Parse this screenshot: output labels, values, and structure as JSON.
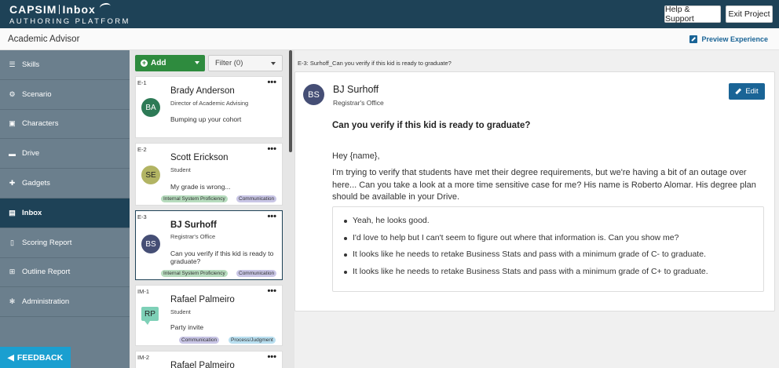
{
  "app": {
    "brand_main": "CAPSIM|Inbox",
    "brand_part1": "CAPSIM",
    "brand_part2": "Inbox",
    "brand_sub": "AUTHORING PLATFORM",
    "help_label": "Help & Support",
    "exit_label": "Exit Project"
  },
  "subheader": {
    "title": "Academic Advisor",
    "preview_label": "Preview Experience"
  },
  "sidebar": {
    "items": [
      {
        "label": "Skills",
        "icon": "list-icon"
      },
      {
        "label": "Scenario",
        "icon": "scenario-icon"
      },
      {
        "label": "Characters",
        "icon": "id-card-icon"
      },
      {
        "label": "Drive",
        "icon": "folder-icon"
      },
      {
        "label": "Gadgets",
        "icon": "puzzle-icon"
      },
      {
        "label": "Inbox",
        "icon": "inbox-icon",
        "active": true
      },
      {
        "label": "Scoring Report",
        "icon": "document-icon"
      },
      {
        "label": "Outline Report",
        "icon": "sitemap-icon"
      },
      {
        "label": "Administration",
        "icon": "gear-icon"
      }
    ],
    "feedback_label": "FEEDBACK"
  },
  "list": {
    "add_label": "Add",
    "filter_label": "Filter (0)",
    "cards": [
      {
        "id": "E-1",
        "initials": "BA",
        "name": "Brady Anderson",
        "role": "Director of Academic Advising",
        "preview": "Bumping up your cohort",
        "tags": []
      },
      {
        "id": "E-2",
        "initials": "SE",
        "name": "Scott Erickson",
        "role": "Student",
        "preview": "My grade is wrong...",
        "tags": [
          "Internal System Proficiency",
          "Communication"
        ]
      },
      {
        "id": "E-3",
        "initials": "BS",
        "name": "BJ Surhoff",
        "role": "Registrar's Office",
        "preview": "Can you verify if this kid is ready to graduate?",
        "tags": [
          "Internal System Proficiency",
          "Communication"
        ]
      },
      {
        "id": "IM-1",
        "initials": "RP",
        "name": "Rafael Palmeiro",
        "role": "Student",
        "preview": "Party invite",
        "tags": [
          "Communication",
          "Process/Judgment"
        ]
      },
      {
        "id": "IM-2",
        "initials": "",
        "name": "Rafael Palmeiro",
        "role": "",
        "preview": "",
        "tags": []
      }
    ]
  },
  "detail": {
    "breadcrumb": "E-3: Surhoff_Can you verify if this kid is ready to graduate?",
    "initials": "BS",
    "sender": "BJ Surhoff",
    "role": "Registrar's Office",
    "edit_label": "Edit",
    "subject": "Can you verify if this kid is ready to graduate?",
    "greeting": "Hey {name},",
    "body": "I'm trying to verify that students have met their degree requirements, but we're having a bit of an outage over here... Can you take a look at a more time sensitive case for me? His name is Roberto Alomar. His degree plan should be available in your Drive.",
    "options": [
      "Yeah, he looks good.",
      "I'd love to help but I can't seem to figure out where that information is. Can you show me?",
      "It looks like he needs to retake Business Stats and pass with a minimum grade of C- to graduate.",
      "It looks like he needs to retake Business Stats and pass with a minimum grade of C+ to graduate."
    ]
  },
  "colors": {
    "topbar": "#1e4257",
    "sidebar": "#6b7f8d",
    "add_button": "#2e8b3e",
    "edit_button": "#1a6496",
    "feedback": "#1a9fd0"
  }
}
